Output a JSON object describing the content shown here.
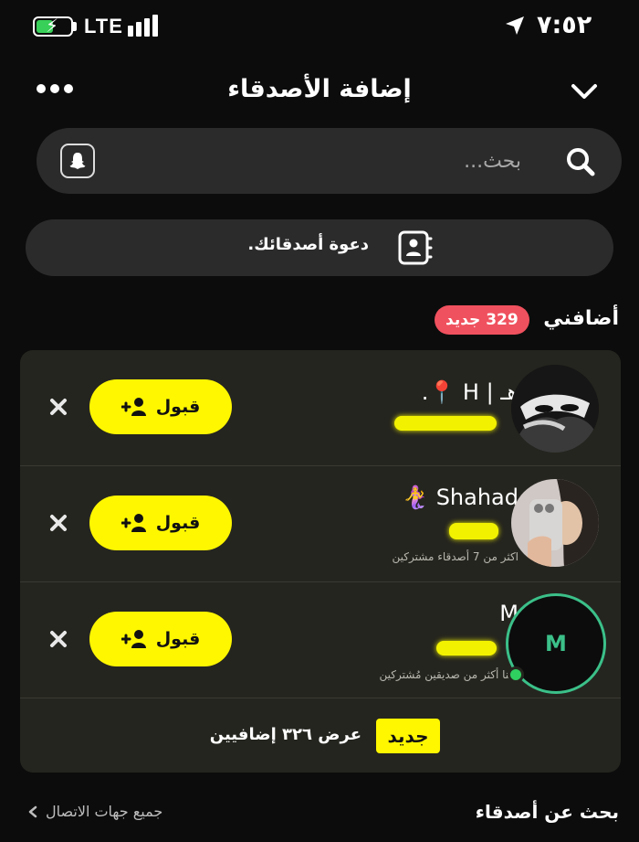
{
  "status_bar": {
    "network": "LTE",
    "time": "٧:٥٢"
  },
  "header": {
    "title": "إضافة الأصدقاء"
  },
  "search": {
    "placeholder": "بحث..."
  },
  "invite": {
    "label": "دعوة أصدقائك."
  },
  "added_me": {
    "title": "أضافني",
    "new_badge": "329 جديد"
  },
  "requests": [
    {
      "name": "هـ | H 📍.",
      "username": "",
      "mutual": "",
      "accept_label": "قبول"
    },
    {
      "name": "Shahad 🧜‍♀️",
      "username": "",
      "mutual": "اكثر من 7 أصدقاء مشتركين",
      "accept_label": "قبول"
    },
    {
      "name": "M",
      "username": "",
      "mutual": "بيننا أكثر من صديقين مُشتركين",
      "accept_label": "قبول",
      "avatar_letter": "M"
    }
  ],
  "view_more": {
    "label": "عرض ٣٢٦ إضافيين",
    "new_tag": "جديد"
  },
  "bottom": {
    "find_friends": "بحث عن أصدقاء",
    "all_contacts": "جميع جهات الاتصال"
  },
  "colors": {
    "accent": "#fff700",
    "badge": "#f0515e",
    "online": "#2fd060",
    "ring": "#3bc089"
  }
}
